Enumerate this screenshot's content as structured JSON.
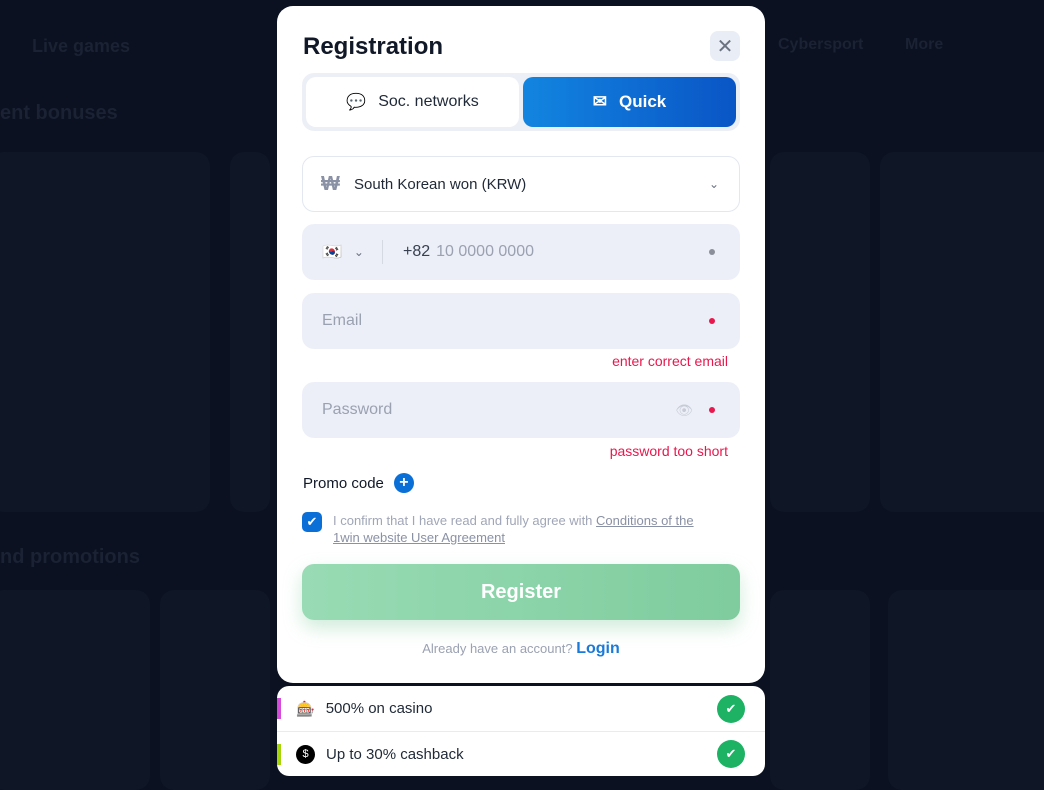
{
  "background": {
    "nav": [
      "Live games",
      "Cybersport",
      "More"
    ],
    "sections": [
      "ent bonuses",
      "nd promotions"
    ]
  },
  "modal": {
    "title": "Registration",
    "tabs": {
      "social": "Soc. networks",
      "quick": "Quick"
    },
    "currency": {
      "symbol": "₩",
      "value": "South Korean won (KRW)"
    },
    "phone": {
      "flag": "🇰🇷",
      "code": "+82",
      "placeholder": "10 0000 0000"
    },
    "email": {
      "placeholder": "Email",
      "error": "enter correct email"
    },
    "password": {
      "placeholder": "Password",
      "error": "password too short"
    },
    "promo_label": "Promo code",
    "agreement": {
      "text": "I confirm that I have read and fully agree with ",
      "link": "Conditions of the 1win website User Agreement",
      "checked": true
    },
    "register": "Register",
    "login_prompt": "Already have an account?",
    "login_link": "Login"
  },
  "bonuses": [
    {
      "icon": "🎰",
      "label": "500% on casino",
      "color": "#d54bd9"
    },
    {
      "icon": "💲",
      "label": "Up to 30% cashback",
      "color": "#a6d40b"
    }
  ],
  "colors": {
    "accent": "#0b6fd8",
    "error": "#e8174d",
    "success": "#1db264"
  }
}
